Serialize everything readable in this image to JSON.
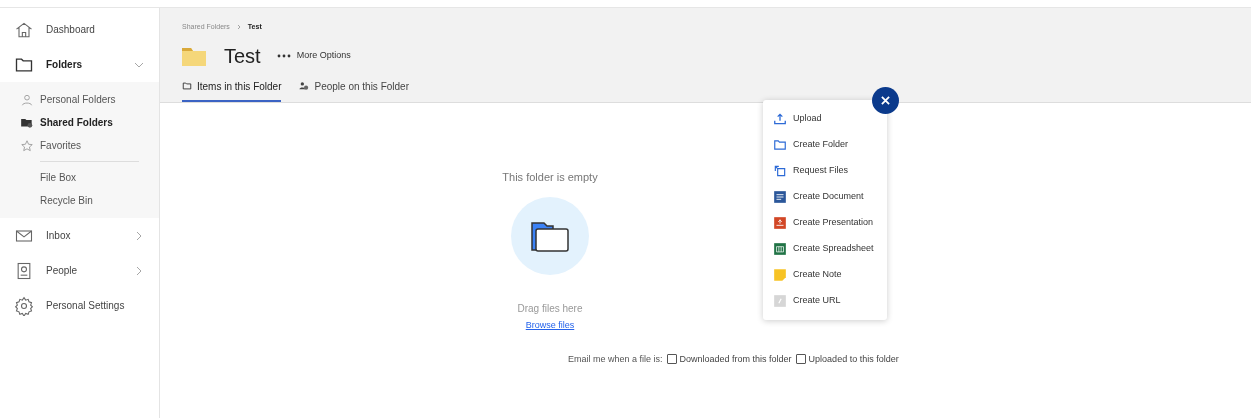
{
  "sidebar": {
    "items": [
      {
        "label": "Dashboard",
        "kind": "home"
      },
      {
        "label": "Folders",
        "kind": "folder",
        "expanded": true,
        "children": [
          {
            "label": "Personal Folders",
            "kind": "person",
            "selected": false
          },
          {
            "label": "Shared Folders",
            "kind": "shared",
            "selected": true
          },
          {
            "label": "Favorites",
            "kind": "star",
            "selected": false
          },
          {
            "label": "File Box",
            "kind": "divided",
            "selected": false
          },
          {
            "label": "Recycle Bin",
            "kind": "plain",
            "selected": false
          }
        ]
      },
      {
        "label": "Inbox",
        "kind": "mail",
        "expanded": false
      },
      {
        "label": "People",
        "kind": "contact",
        "expanded": false
      },
      {
        "label": "Personal Settings",
        "kind": "gear"
      }
    ]
  },
  "breadcrumb": [
    "Shared Folders",
    "Test"
  ],
  "title": "Test",
  "more_options": "More Options",
  "tabs": [
    {
      "label": "Items in this Folder",
      "kind": "folder",
      "selected": true
    },
    {
      "label": "People on this Folder",
      "kind": "people",
      "selected": false
    }
  ],
  "empty_state": {
    "message": "This folder is empty",
    "hint": "Drag files here",
    "link": "Browse files"
  },
  "email_options": {
    "label": "Email me when a file is:",
    "options": [
      {
        "label": "Downloaded from this folder",
        "checked": false
      },
      {
        "label": "Uploaded to this folder",
        "checked": false
      }
    ]
  },
  "menu": {
    "items": [
      {
        "label": "Upload",
        "kind": "upload"
      },
      {
        "label": "Create Folder",
        "kind": "folder"
      },
      {
        "label": "Request Files",
        "kind": "request"
      },
      {
        "label": "Create Document",
        "kind": "document"
      },
      {
        "label": "Create Presentation",
        "kind": "presentation"
      },
      {
        "label": "Create Spreadsheet",
        "kind": "spreadsheet"
      },
      {
        "label": "Create Note",
        "kind": "note"
      },
      {
        "label": "Create URL",
        "kind": "url"
      }
    ]
  }
}
